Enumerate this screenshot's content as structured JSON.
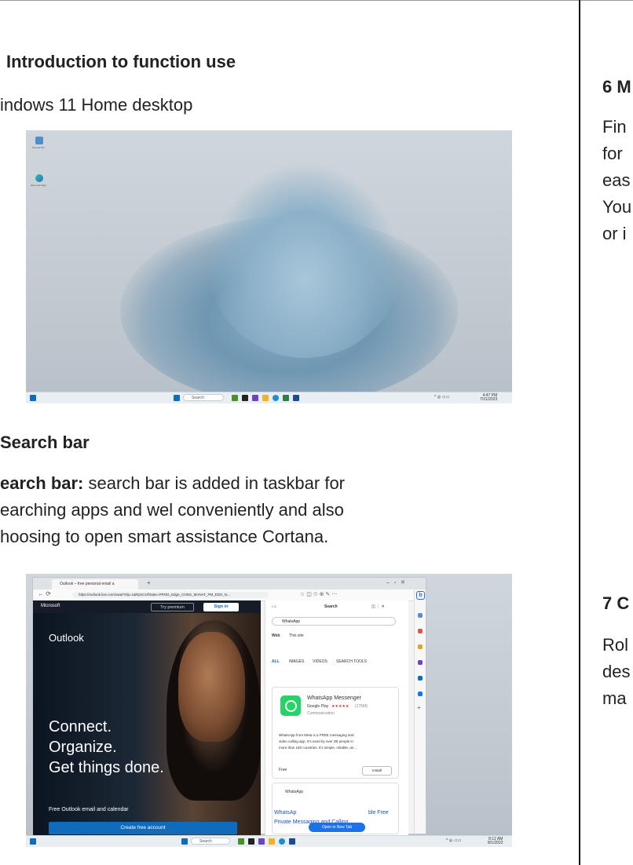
{
  "left_column": {
    "section_intro_heading": "Introduction to function use",
    "intro_caption": "indows 11 Home desktop",
    "section_search_heading": "Search bar",
    "search_para": {
      "bold_label": "earch bar:",
      "line1_rest": " search bar is added in taskbar for",
      "line2": "earching apps and wel conveniently and also",
      "line3": "hoosing to open smart assistance Cortana."
    }
  },
  "right_column": {
    "heading_6": "6 M",
    "para_6": [
      "Fin",
      "for",
      "eas",
      "You",
      "or i"
    ],
    "heading_7": "7 C",
    "para_7": [
      "Rol",
      "des",
      "ma"
    ]
  },
  "desktop_screenshot": {
    "icons": [
      {
        "name": "recycle-bin-icon",
        "label": "Recycle Bin"
      },
      {
        "name": "edge-icon",
        "label": "Microsoft Edge"
      }
    ],
    "taskbar": {
      "search_placeholder": "Search",
      "tray_time": "4:47 PM",
      "tray_date": "7/31/2023"
    }
  },
  "browser_screenshot": {
    "tab_title": "Outlook – free personal email a",
    "url": "https://outlook.live.com/owa/?nlp=1&RpsCsrfState=PROD_Edge_CONS_MANAT_PM_EDG_N...",
    "outlook": {
      "brand": "Microsoft",
      "try_premium": "Try premium",
      "sign_in": "Sign in",
      "app_name": "Outlook",
      "hero_lines": [
        "Connect.",
        "Organize.",
        "Get things done."
      ],
      "free_text": "Free Outlook email and calendar",
      "create_button": "Create free account"
    },
    "sidebar": {
      "title": "Search",
      "query": "WhatsApp",
      "scope_tabs": [
        "Web",
        "This site"
      ],
      "filter_tabs": [
        "ALL",
        "IMAGES",
        "VIDEOS",
        "SEARCH TOOLS"
      ],
      "result_title": "WhatsApp Messenger",
      "result_store": "Google Play",
      "result_rating": "★★★★★",
      "result_reviews": "(176M)",
      "result_category": "Communication",
      "result_desc": [
        "WhatsApp from Meta is a FREE messaging and",
        "video calling app. It's used by over 2B people in",
        "more than 180 countries. It's simple, reliable, an..."
      ],
      "price": "Free",
      "install": "Install",
      "result2_title": "WhatsApp",
      "result2_link_a": "WhatsAp",
      "result2_link_b": "ble Free",
      "result2_link_line2": "Private Messaging and Calling",
      "open_new_tab": "Open in New Tab"
    },
    "taskbar": {
      "search_placeholder": "Search",
      "tray_time": "8:12 AM",
      "tray_date": "8/1/2023"
    }
  },
  "colors": {
    "windows_blue": "#0f6cbd",
    "whatsapp_green": "#25d366"
  }
}
